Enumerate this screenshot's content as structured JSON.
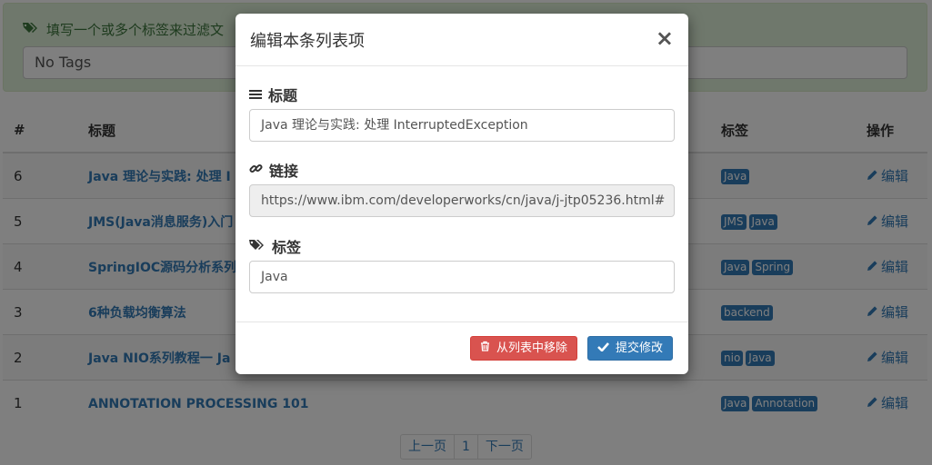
{
  "filter": {
    "heading": "填写一个或多个标签来过滤文",
    "input_value": "No Tags"
  },
  "table": {
    "headers": {
      "num": "#",
      "title": "标题",
      "tags": "标签",
      "action": "操作"
    },
    "rows": [
      {
        "num": "6",
        "title": "Java 理论与实践: 处理 I",
        "tags": [
          "Java"
        ],
        "action": "编辑"
      },
      {
        "num": "5",
        "title": "JMS(Java消息服务)入门",
        "tags": [
          "JMS",
          "Java"
        ],
        "action": "编辑"
      },
      {
        "num": "4",
        "title": "SpringIOC源码分析系列",
        "tags": [
          "Java",
          "Spring"
        ],
        "action": "编辑"
      },
      {
        "num": "3",
        "title": "6种负载均衡算法",
        "tags": [
          "backend"
        ],
        "action": "编辑"
      },
      {
        "num": "2",
        "title": "Java NIO系列教程一 Ja",
        "tags": [
          "nio",
          "Java"
        ],
        "action": "编辑"
      },
      {
        "num": "1",
        "title": "ANNOTATION PROCESSING 101",
        "tags": [
          "Java",
          "Annotation"
        ],
        "action": "编辑"
      }
    ]
  },
  "pagination": {
    "prev": "上一页",
    "current": "1",
    "next": "下一页"
  },
  "modal": {
    "title": "编辑本条列表项",
    "close": "×",
    "title_label": "标题",
    "title_value": "Java 理论与实践: 处理 InterruptedException",
    "link_label": "链接",
    "link_value": "https://www.ibm.com/developerworks/cn/java/j-jtp05236.html#",
    "tags_label": "标签",
    "tags_value": "Java",
    "remove_button": "从列表中移除",
    "submit_button": "提交修改"
  },
  "icons": {
    "filter_tags": "tags-icon",
    "title_field": "bars-icon",
    "link_field": "link-icon",
    "tags_field": "tags-icon",
    "edit": "pencil-icon",
    "remove": "trash-icon",
    "submit": "check-icon"
  },
  "colors": {
    "primary": "#337ab7",
    "danger": "#d9534f",
    "success_bg": "#dff0d8",
    "success_text": "#3c763d"
  }
}
